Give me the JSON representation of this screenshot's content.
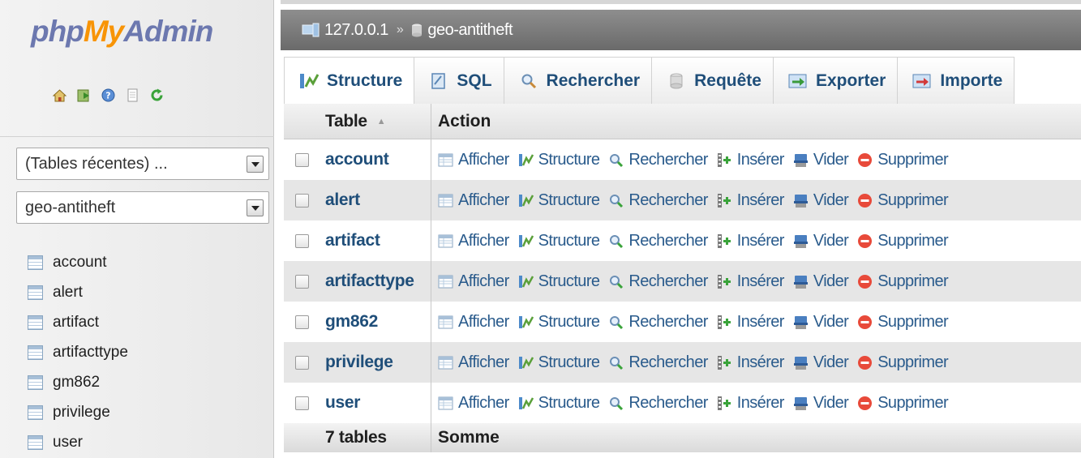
{
  "app": {
    "logo": {
      "php": "php",
      "my": "My",
      "admin": "Admin"
    }
  },
  "sidebar": {
    "nav_icons": [
      "home-icon",
      "sql-query-icon",
      "help-icon",
      "documentation-icon",
      "reload-icon"
    ],
    "recent_tables_select": "(Tables récentes) ...",
    "database_select": "geo-antitheft",
    "tables": [
      "account",
      "alert",
      "artifact",
      "artifacttype",
      "gm862",
      "privilege",
      "user"
    ]
  },
  "breadcrumb": {
    "server": "127.0.0.1",
    "separator": "»",
    "database": "geo-antitheft"
  },
  "tabs": [
    {
      "label": "Structure",
      "icon": "structure-icon",
      "active": true
    },
    {
      "label": "SQL",
      "icon": "sql-icon",
      "active": false
    },
    {
      "label": "Rechercher",
      "icon": "search-icon",
      "active": false
    },
    {
      "label": "Requête",
      "icon": "query-icon",
      "active": false
    },
    {
      "label": "Exporter",
      "icon": "export-icon",
      "active": false
    },
    {
      "label": "Importe",
      "icon": "import-icon",
      "active": false
    }
  ],
  "table": {
    "headers": {
      "table": "Table",
      "action": "Action"
    },
    "actions": {
      "browse": "Afficher",
      "structure": "Structure",
      "search": "Rechercher",
      "insert": "Insérer",
      "empty": "Vider",
      "drop": "Supprimer"
    },
    "rows": [
      "account",
      "alert",
      "artifact",
      "artifacttype",
      "gm862",
      "privilege",
      "user"
    ],
    "footer": {
      "count": "7 tables",
      "sum": "Somme"
    }
  },
  "colors": {
    "link": "#1f4e79",
    "action_link": "#2a5b8c",
    "logo_blue": "#6c78af",
    "logo_orange": "#f89406",
    "breadcrumb_bg": "#7a7a7a"
  }
}
